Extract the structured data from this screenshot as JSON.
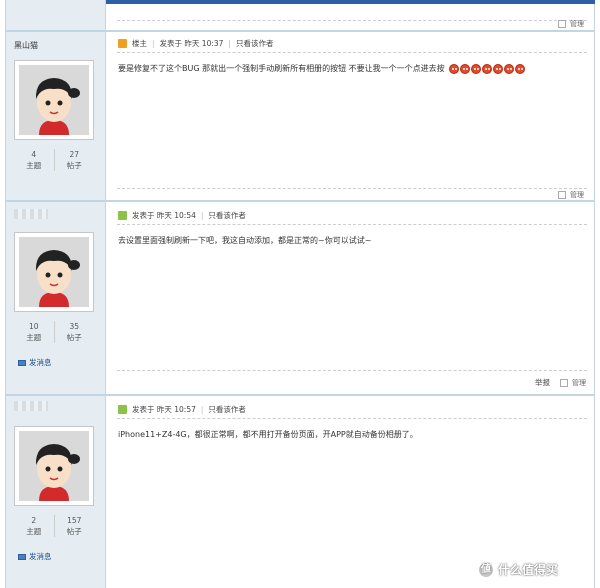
{
  "posts": [
    {
      "username": "黑山猫",
      "stats": {
        "topics_value": "4",
        "topics_label": "主题",
        "posts_value": "27",
        "posts_label": "帖子"
      },
      "badge": "楼主",
      "posted": "发表于 昨天 10:37",
      "only_author": "只看该作者",
      "text": "要是修复不了这个BUG  那就出一个强制手动刷新所有相册的按钮  不要让我一个一个点进去按",
      "emoji_count": 7
    },
    {
      "username": "",
      "stats": {
        "topics_value": "10",
        "topics_label": "主题",
        "posts_value": "35",
        "posts_label": "帖子"
      },
      "send_message": "发消息",
      "posted": "发表于 昨天 10:54",
      "only_author": "只看该作者",
      "text": "去设置里面强制刷新一下吧，我这自动添加，都是正常的~你可以试试~",
      "report": "举报"
    },
    {
      "username": "",
      "stats": {
        "topics_value": "2",
        "topics_label": "主题",
        "posts_value": "157",
        "posts_label": "帖子"
      },
      "send_message": "发消息",
      "posted": "发表于 昨天 10:57",
      "only_author": "只看该作者",
      "text": "iPhone11+Z4-4G，都很正常啊，都不用打开备份页面，开APP就自动备份相册了。"
    }
  ],
  "manage_label": "管理",
  "watermark": "什么值得买",
  "colors": {
    "sidebar": "#e5edf2",
    "accent": "#2f5fa3",
    "link": "#1b4d8e",
    "badge_orange": "#f0a020",
    "badge_green": "#8bc34a"
  }
}
